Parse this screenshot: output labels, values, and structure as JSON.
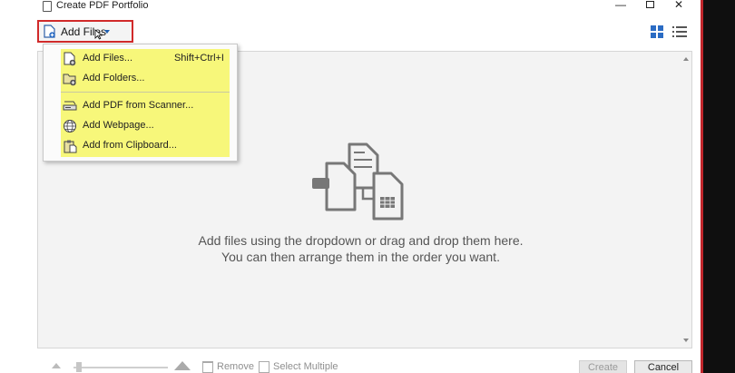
{
  "window": {
    "title": "Create PDF Portfolio",
    "minimize": "—",
    "close": "✕"
  },
  "toolbar": {
    "add_files_label": "Add Files"
  },
  "menu": {
    "items": [
      {
        "label": "Add Files...",
        "shortcut": "Shift+Ctrl+I",
        "icon": "add-file-icon"
      },
      {
        "label": "Add Folders...",
        "shortcut": "",
        "icon": "add-folder-icon"
      },
      {
        "label": "Add PDF from Scanner...",
        "shortcut": "",
        "icon": "scanner-icon"
      },
      {
        "label": "Add Webpage...",
        "shortcut": "",
        "icon": "globe-icon"
      },
      {
        "label": "Add from Clipboard...",
        "shortcut": "",
        "icon": "clipboard-icon"
      }
    ],
    "highlight_color": "#f7f77a"
  },
  "drop_area": {
    "line1": "Add files using the dropdown or drag and drop them here.",
    "line2": "You can then arrange them in the order you want."
  },
  "footer": {
    "remove_label": "Remove",
    "select_multiple_label": "Select Multiple",
    "create_label": "Create",
    "cancel_label": "Cancel"
  },
  "colors": {
    "accent": "#2b6cc4",
    "highlight_border": "#d12a2a"
  }
}
